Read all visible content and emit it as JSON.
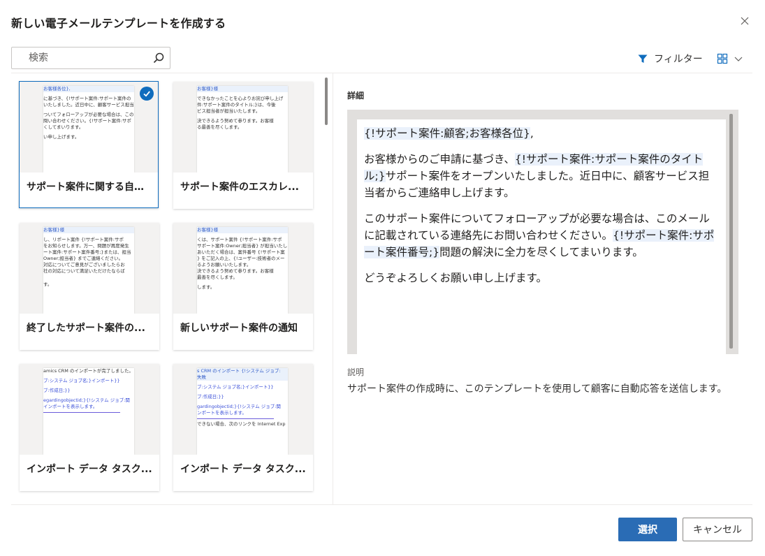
{
  "dialog": {
    "title": "新しい電子メールテンプレートを作成する",
    "close_icon": "close-icon"
  },
  "toolbar": {
    "search_placeholder": "検索",
    "filter_label": "フィルター",
    "view_icon": "grid-view-icon"
  },
  "templates": [
    {
      "name": "サポート案件に関する自動...",
      "selected": true,
      "thumb_lines": [
        {
          "t": "お客様各位},",
          "s": "hl"
        },
        {
          "t": "",
          "s": ""
        },
        {
          "t": "に基づき、{!サポート案件:サポート案件の",
          "s": ""
        },
        {
          "t": "いたしました。近日中に、顧客サービス担当",
          "s": ""
        },
        {
          "t": "",
          "s": ""
        },
        {
          "t": "ついてフォローアップが必要な場合は、この",
          "s": ""
        },
        {
          "t": "問い合わせください。{!サポート案件:サポ",
          "s": ""
        },
        {
          "t": "くしてまいります。",
          "s": ""
        },
        {
          "t": "",
          "s": ""
        },
        {
          "t": "い申し上げます。",
          "s": ""
        }
      ]
    },
    {
      "name": "サポート案件のエスカレ...",
      "selected": false,
      "thumb_lines": [
        {
          "t": "お客様}様",
          "s": "hl"
        },
        {
          "t": "",
          "s": ""
        },
        {
          "t": "できなかったことを心よりお詫び申し上げ",
          "s": ""
        },
        {
          "t": "件:サポート案件のタイトル;}は、今後",
          "s": ""
        },
        {
          "t": "ビス担当者が担当いたします。",
          "s": ""
        },
        {
          "t": "",
          "s": ""
        },
        {
          "t": "決できるよう努めて参ります。お客様",
          "s": ""
        },
        {
          "t": "る最善を尽くします。",
          "s": ""
        }
      ]
    },
    {
      "name": "終了したサポート案件の...",
      "selected": false,
      "thumb_lines": [
        {
          "t": "お客様}様",
          "s": "hl"
        },
        {
          "t": "",
          "s": ""
        },
        {
          "t": "し、リポート案件 {!サポート案件:サポ",
          "s": ""
        },
        {
          "t": "をお知らせします。万一、問題が再度発生",
          "s": ""
        },
        {
          "t": "ート案件:サポート案件番号;}または、担当",
          "s": ""
        },
        {
          "t": "Owner;担当者} までご連絡ください。",
          "s": ""
        },
        {
          "t": "対応についてご意見がございましたらお",
          "s": ""
        },
        {
          "t": "社の対応について満足いただけたならば",
          "s": ""
        },
        {
          "t": "",
          "s": ""
        },
        {
          "t": "",
          "s": ""
        },
        {
          "t": "す。",
          "s": ""
        }
      ]
    },
    {
      "name": "新しいサポート案件の通知",
      "selected": false,
      "thumb_lines": [
        {
          "t": "お客様}様",
          "s": "hl"
        },
        {
          "t": "",
          "s": ""
        },
        {
          "t": "くは、サポート案件 {!サポート案件:サポ",
          "s": ""
        },
        {
          "t": "サポート案件:Owner;担当者} が担当いたし",
          "s": ""
        },
        {
          "t": "あいただく場合は、案件番号 {!サポート案",
          "s": ""
        },
        {
          "t": "} をご記入の上、{!ユーザー:技術者のメー",
          "s": ""
        },
        {
          "t": "るようお願いいたします。",
          "s": ""
        },
        {
          "t": "決できるよう努めて参ります。お客様",
          "s": ""
        },
        {
          "t": "最善を尽くします。",
          "s": ""
        },
        {
          "t": "",
          "s": ""
        },
        {
          "t": "します。",
          "s": ""
        }
      ]
    },
    {
      "name": "インポート データ タスク...",
      "selected": false,
      "thumb_lines": [
        {
          "t": "amics CRM のインポートが完了しました。",
          "s": ""
        },
        {
          "t": "",
          "s": ""
        },
        {
          "t": "ブ:システム ジョブ名;}インポート}}",
          "s": "link"
        },
        {
          "t": "",
          "s": ""
        },
        {
          "t": "ブ:作成日;}}",
          "s": "link"
        },
        {
          "t": "",
          "s": ""
        },
        {
          "t": "egardingobjectid;}{!システム ジョブ:関",
          "s": "link"
        },
        {
          "t": "インポートを表示します。",
          "s": "link"
        },
        {
          "t": "",
          "s": "rule"
        }
      ]
    },
    {
      "name": "インポート データ タスク...",
      "selected": false,
      "thumb_lines": [
        {
          "t": "s CRM のインポート {!システム ジョブ:",
          "s": "hl"
        },
        {
          "t": "失敗",
          "s": "hl"
        },
        {
          "t": "",
          "s": ""
        },
        {
          "t": "ブ:システム ジョブ名;}インポート}}",
          "s": "link"
        },
        {
          "t": "",
          "s": ""
        },
        {
          "t": "ブ:作成日;}}",
          "s": "link"
        },
        {
          "t": "",
          "s": ""
        },
        {
          "t": "gardingobjectid;}{!システム ジョブ:関",
          "s": "link"
        },
        {
          "t": "ンポートを表示します。",
          "s": "link"
        },
        {
          "t": "",
          "s": "rule"
        },
        {
          "t": "できない場合、次のリンクを Internet Exp",
          "s": ""
        }
      ]
    }
  ],
  "details": {
    "heading": "詳細",
    "preview": {
      "greeting_token": "{!サポート案件:顧客;お客様各位}",
      "greeting_suffix": ",",
      "p1_a": "お客様からのご申請に基づき、",
      "p1_token": "{!サポート案件:サポート案件のタイトル;}",
      "p1_b": "サポート案件をオープンいたしました。近日中に、顧客サービス担当者からご連絡申し上げます。",
      "p2_a": "このサポート案件についてフォローアップが必要な場合は、このメールに記載されている連絡先にお問い合わせください。",
      "p2_token": "{!サポート案件:サポート案件番号;}",
      "p2_b": "問題の解決に全力を尽くしてまいります。",
      "p3": "どうぞよろしくお願い申し上げます。"
    },
    "description_label": "説明",
    "description_text": "サポート案件の作成時に、このテンプレートを使用して顧客に自動応答を送信します。"
  },
  "footer": {
    "select_label": "選択",
    "cancel_label": "キャンセル"
  },
  "colors": {
    "accent": "#0f6cbd",
    "primary_button": "#2a6cb5",
    "token_highlight": "#eaf1fb"
  }
}
